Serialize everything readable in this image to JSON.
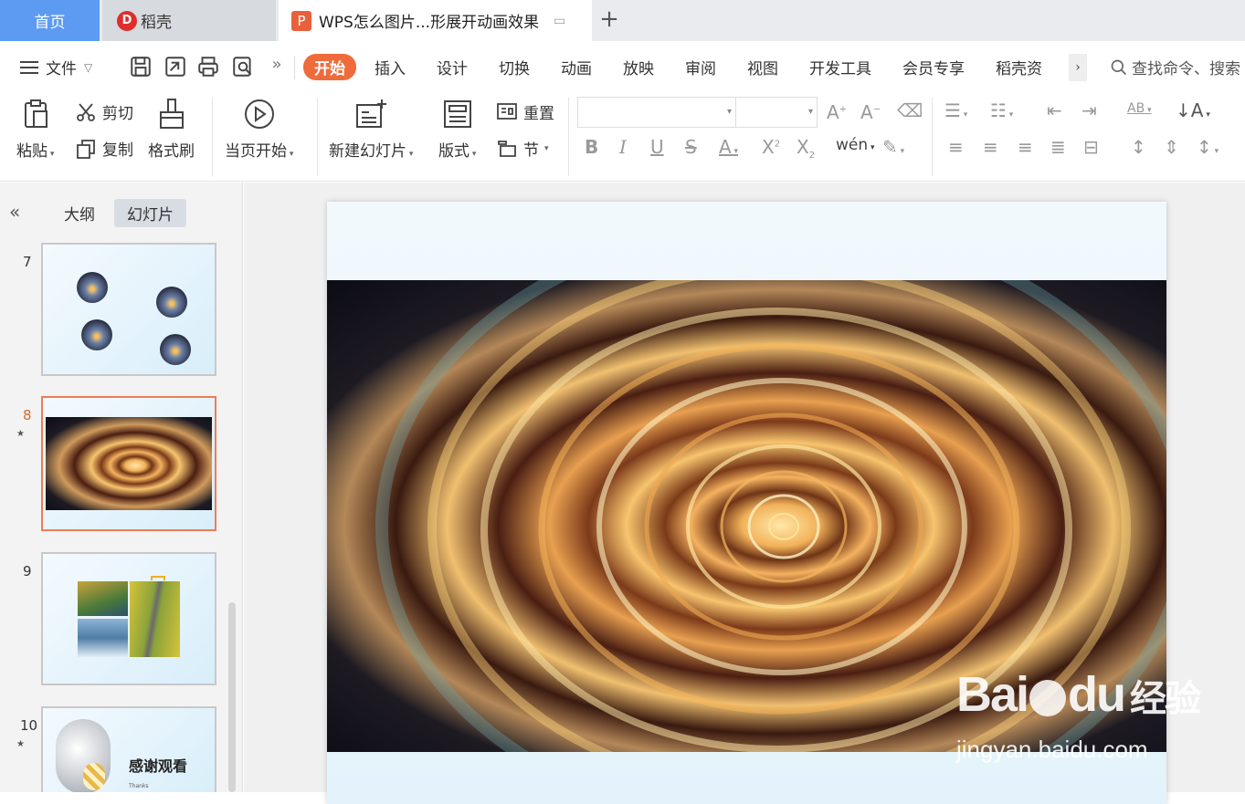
{
  "tabs": {
    "home": "首页",
    "daoke": "稻壳",
    "doc": "WPS怎么图片...形展开动画效果"
  },
  "menu": {
    "file": "文件",
    "tabs": [
      "开始",
      "插入",
      "设计",
      "切换",
      "动画",
      "放映",
      "审阅",
      "视图",
      "开发工具",
      "会员专享",
      "稻壳资"
    ],
    "active_tab": "开始",
    "search": "查找命令、搜索"
  },
  "ribbon": {
    "paste": "粘贴",
    "cut": "剪切",
    "copy": "复制",
    "format_painter": "格式刷",
    "play_current": "当页开始",
    "new_slide": "新建幻灯片",
    "layout": "版式",
    "reset": "重置",
    "section": "节"
  },
  "panel": {
    "outline_tab": "大纲",
    "slides_tab": "幻灯片",
    "slides": [
      {
        "num": "7",
        "star": ""
      },
      {
        "num": "8",
        "star": "★"
      },
      {
        "num": "9",
        "star": ""
      },
      {
        "num": "10",
        "star": "★"
      }
    ],
    "selected": "8",
    "slide10_text": "感谢观看",
    "slide10_sub": "Thanks"
  },
  "watermark": {
    "brand": "Bai",
    "brand2": "du",
    "jingyan": "经验",
    "url": "jingyan.baidu.com"
  },
  "colors": {
    "accent": "#f06b3b",
    "home_tab": "#5d9bf2"
  }
}
